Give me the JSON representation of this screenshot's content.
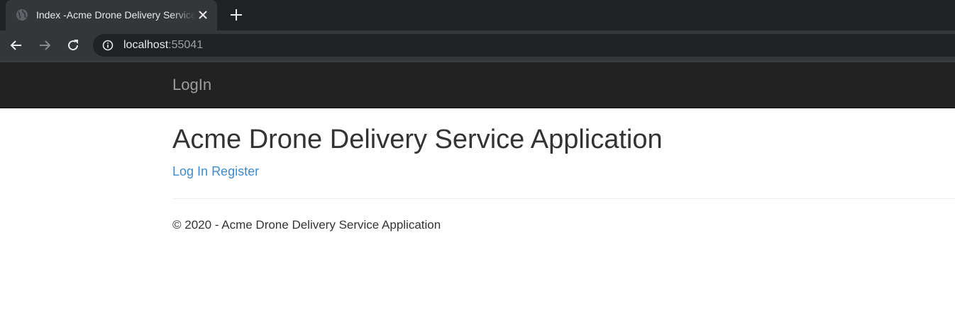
{
  "browser": {
    "tab": {
      "title": "Index -Acme Drone Delivery Service Application",
      "favicon": "globe-icon",
      "close_icon": "close-icon"
    },
    "new_tab_icon": "plus-icon",
    "toolbar": {
      "back_icon": "arrow-left-icon",
      "forward_icon": "arrow-right-icon",
      "reload_icon": "reload-icon",
      "site_info_icon": "info-icon",
      "url_host": "localhost",
      "url_port": ":55041"
    }
  },
  "page": {
    "navbar": {
      "brand": "LogIn"
    },
    "heading": "Acme Drone Delivery Service Application",
    "links": {
      "login": "Log In",
      "register": "Register"
    },
    "footer": "© 2020 - Acme Drone Delivery Service Application"
  },
  "colors": {
    "tabstrip_bg": "#202124",
    "toolbar_bg": "#35363a",
    "navbar_bg": "#222222",
    "link": "#428bca",
    "text": "#333333"
  }
}
